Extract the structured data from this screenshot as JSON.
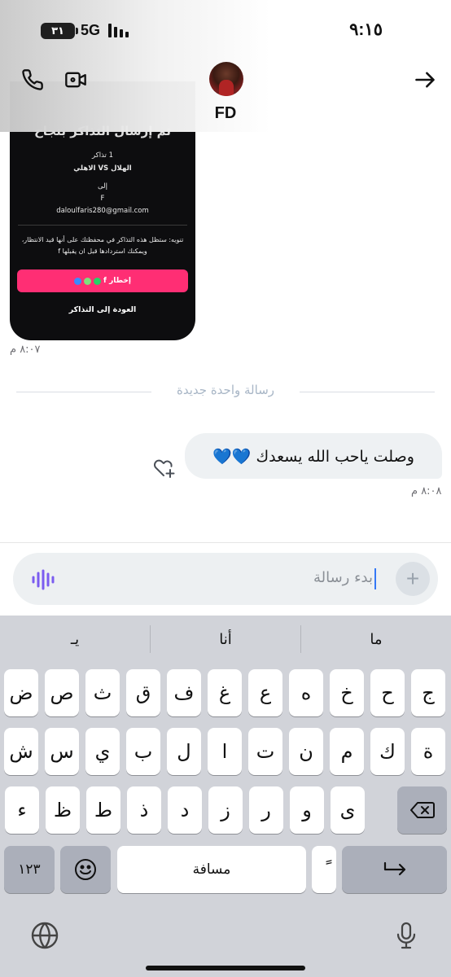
{
  "status": {
    "battery": "٣١",
    "network": "5G",
    "time": "٩:١٥"
  },
  "header": {
    "contact_name": "FD",
    "icons": [
      "phone-icon",
      "video-camera-icon",
      "arrow-right-icon"
    ]
  },
  "shared_screenshot": {
    "title": "تم إرسال التذاكر بنجاح",
    "ticket_count": "1 تذاكر",
    "match": "الهلال VS الاهلي",
    "to_label": "إلى",
    "recipient_name": "F",
    "recipient_email": "daloulfaris280@gmail.com",
    "note": "تنويه: ستظل هذه التذاكر في محفظتك على أنها قيد الانتظار، ويمكنك استردادها قبل ان يقبلها f",
    "notify_button": "إخطار f",
    "back_button": "العودة إلى التذاكر",
    "timestamp": "٨:٠٧ م"
  },
  "divider_text": "رسالة واحدة جديدة",
  "message": {
    "text": "وصلت ياحب الله يسعدك 💙💙",
    "timestamp": "٨:٠٨ م"
  },
  "composer": {
    "placeholder": "بدء رسالة"
  },
  "keyboard": {
    "suggestions": [
      "ما",
      "أنا",
      "يـ"
    ],
    "row1": [
      "ج",
      "ح",
      "خ",
      "ه",
      "ع",
      "غ",
      "ف",
      "ق",
      "ث",
      "ص",
      "ض"
    ],
    "row2": [
      "ة",
      "ك",
      "م",
      "ن",
      "ت",
      "ا",
      "ل",
      "ب",
      "ي",
      "س",
      "ش"
    ],
    "row3": [
      "ى",
      "و",
      "ر",
      "ز",
      "د",
      "ذ",
      "ط",
      "ظ",
      "ء"
    ],
    "numbers_key": "١٢٣",
    "space_key": "مسافة",
    "diacritic_key": "ً"
  }
}
